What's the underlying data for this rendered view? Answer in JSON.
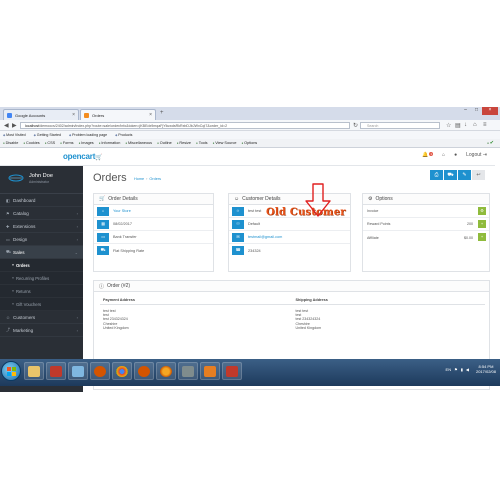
{
  "browser": {
    "tabs": [
      {
        "label": "Google Accounts",
        "icon": "google-icon"
      },
      {
        "label": "Orders",
        "icon": "opencart-icon"
      }
    ],
    "url_host": "localhost",
    "url_rest": "/demoocs/2402/admin/index.php?route=sale/order/info&token=jKBEdx9mqaFjYliuwdsRkRxbDJbJWxCqI7&order_id=2",
    "search_placeholder": "Search",
    "bookmarks": [
      "Most Visited",
      "Getting Started",
      "Problem loading page",
      "Products"
    ],
    "devtools": [
      "Disable",
      "Cookies",
      "CSS",
      "Forms",
      "Images",
      "Information",
      "Miscellaneous",
      "Outline",
      "Resize",
      "Tools",
      "View Source",
      "Options"
    ]
  },
  "header": {
    "logo": "opencart",
    "notif_count": "1",
    "logout": "Logout"
  },
  "sidebar": {
    "user_name": "John Doe",
    "user_role": "Administrator",
    "items": [
      {
        "label": "Dashboard",
        "icon": "dashboard-icon"
      },
      {
        "label": "Catalog",
        "icon": "tag-icon"
      },
      {
        "label": "Extensions",
        "icon": "puzzle-icon"
      },
      {
        "label": "Design",
        "icon": "monitor-icon"
      },
      {
        "label": "Sales",
        "icon": "cart-icon"
      }
    ],
    "sub_items": [
      "Orders",
      "Recurring Profiles",
      "Returns",
      "Gift Vouchers"
    ],
    "after_items": [
      {
        "label": "Customers",
        "icon": "user-icon"
      },
      {
        "label": "Marketing",
        "icon": "share-icon"
      }
    ]
  },
  "page": {
    "title": "Orders",
    "breadcrumb_home": "Home",
    "breadcrumb_current": "Orders"
  },
  "order_details": {
    "heading": "Order Details",
    "store": "Your Store",
    "date": "08/02/2017",
    "payment": "Bank Transfer",
    "shipping": "Flat Shipping Rate"
  },
  "customer_details": {
    "heading": "Customer Details",
    "name": "test test",
    "group": "Default",
    "email": "testmail@gmail.com",
    "phone": "234324",
    "annotation": "Old Customer"
  },
  "options": {
    "heading": "Options",
    "rows": [
      {
        "label": "Invoice",
        "value": ""
      },
      {
        "label": "Reward Points",
        "value": "200"
      },
      {
        "label": "Affiliate",
        "value": "$0.00"
      }
    ]
  },
  "order": {
    "heading": "Order (#2)",
    "payment_address_label": "Payment Address",
    "shipping_address_label": "Shipping Address",
    "payment_address": [
      "test test",
      "test",
      "test 234324324",
      "Cheshire",
      "United Kingdom"
    ],
    "shipping_address": [
      "test test",
      "test",
      "test 234324324",
      "Cheshire",
      "United Kingdom"
    ]
  },
  "taskbar": {
    "lang": "EN",
    "time": "8:54 PM",
    "date": "2017/02/08"
  }
}
